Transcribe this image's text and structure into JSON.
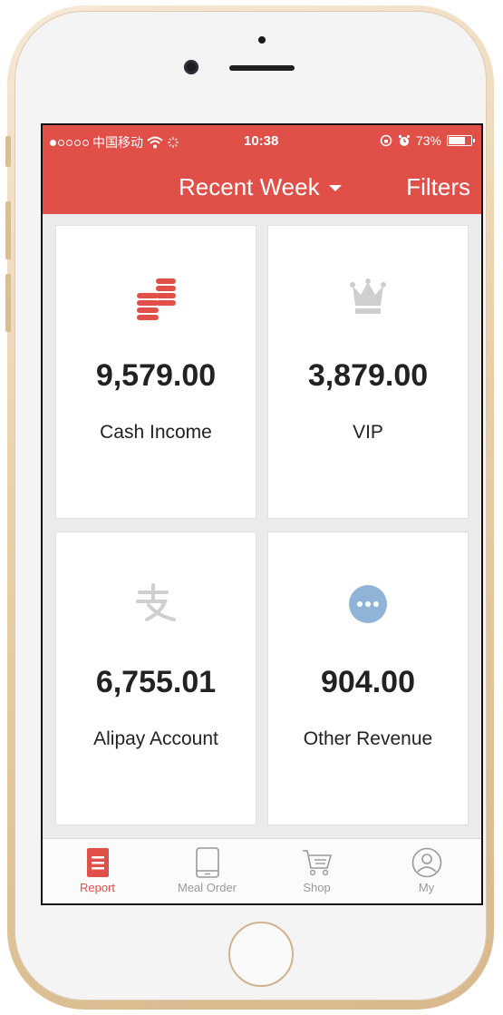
{
  "status_bar": {
    "carrier": "中国移动",
    "time": "10:38",
    "battery": "73%",
    "battery_level": 0.73
  },
  "nav": {
    "title": "Recent Week",
    "filters": "Filters"
  },
  "cards": [
    {
      "value": "9,579.00",
      "label": "Cash Income",
      "icon": "coins-icon",
      "color": "#e05048"
    },
    {
      "value": "3,879.00",
      "label": "VIP",
      "icon": "crown-icon",
      "color": "#cfcfcf"
    },
    {
      "value": "6,755.01",
      "label": "Alipay Account",
      "icon": "alipay-icon",
      "color": "#d0d0d0"
    },
    {
      "value": "904.00",
      "label": "Other Revenue",
      "icon": "more-icon",
      "color": "#8fb4d8"
    }
  ],
  "tabs": [
    {
      "label": "Report",
      "icon": "report-icon",
      "active": true
    },
    {
      "label": "Meal Order",
      "icon": "tablet-icon",
      "active": false
    },
    {
      "label": "Shop",
      "icon": "cart-icon",
      "active": false
    },
    {
      "label": "My",
      "icon": "user-icon",
      "active": false
    }
  ],
  "colors": {
    "accent": "#e05048",
    "inactive_tab": "#999999",
    "background": "#ebebeb"
  }
}
